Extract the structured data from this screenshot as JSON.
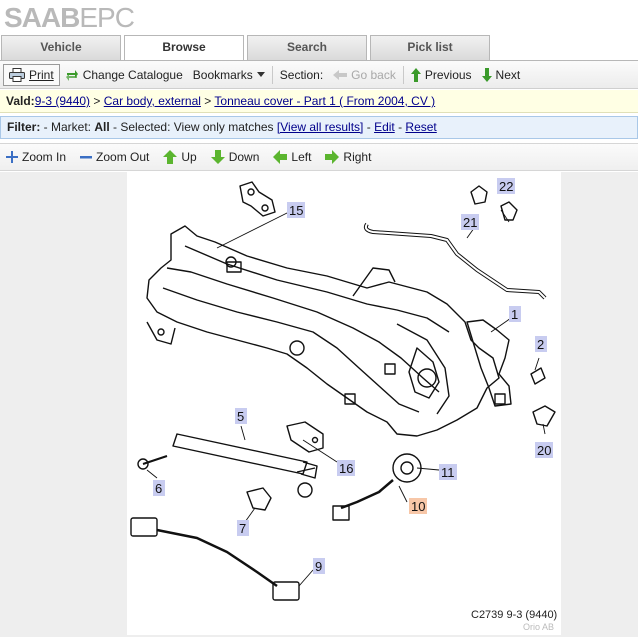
{
  "app": {
    "logo_bold": "SAAB",
    "logo_light": "EPC"
  },
  "tabs": [
    {
      "label": "Vehicle",
      "active": false
    },
    {
      "label": "Browse",
      "active": true
    },
    {
      "label": "Search",
      "active": false
    },
    {
      "label": "Pick list",
      "active": false
    }
  ],
  "toolbar": {
    "print": "Print",
    "change_catalogue": "Change Catalogue",
    "bookmarks": "Bookmarks",
    "section_label": "Section:",
    "go_back": "Go back",
    "previous": "Previous",
    "next": "Next"
  },
  "breadcrumb": {
    "label": "Vald:",
    "model": "9-3 (9440)",
    "sep1": " > ",
    "group": "Car body, external",
    "sep2": " > ",
    "section": "Tonneau cover - Part 1 ( From 2004, CV )"
  },
  "filter": {
    "label": "Filter:",
    "market_prefix": " - Market: ",
    "market_value": "All",
    "selected_prefix": " - Selected: ",
    "selected_value": "View only matches ",
    "view_all": "[View all results]",
    "dash1": " - ",
    "edit": "Edit",
    "dash2": " - ",
    "reset": "Reset"
  },
  "zoom": {
    "zoom_in": "Zoom In",
    "zoom_out": "Zoom Out",
    "up": "Up",
    "down": "Down",
    "left": "Left",
    "right": "Right"
  },
  "diagram": {
    "callouts": [
      "15",
      "22",
      "21",
      "1",
      "2",
      "20",
      "5",
      "16",
      "11",
      "6",
      "10",
      "7",
      "9"
    ],
    "code": "C2739 9-3 (9440)",
    "watermark": "Orio AB"
  },
  "colors": {
    "callout_bg": "#c8ccf0",
    "callout_hl": "#f7c7a8",
    "accent_green": "#3a9a2a"
  }
}
